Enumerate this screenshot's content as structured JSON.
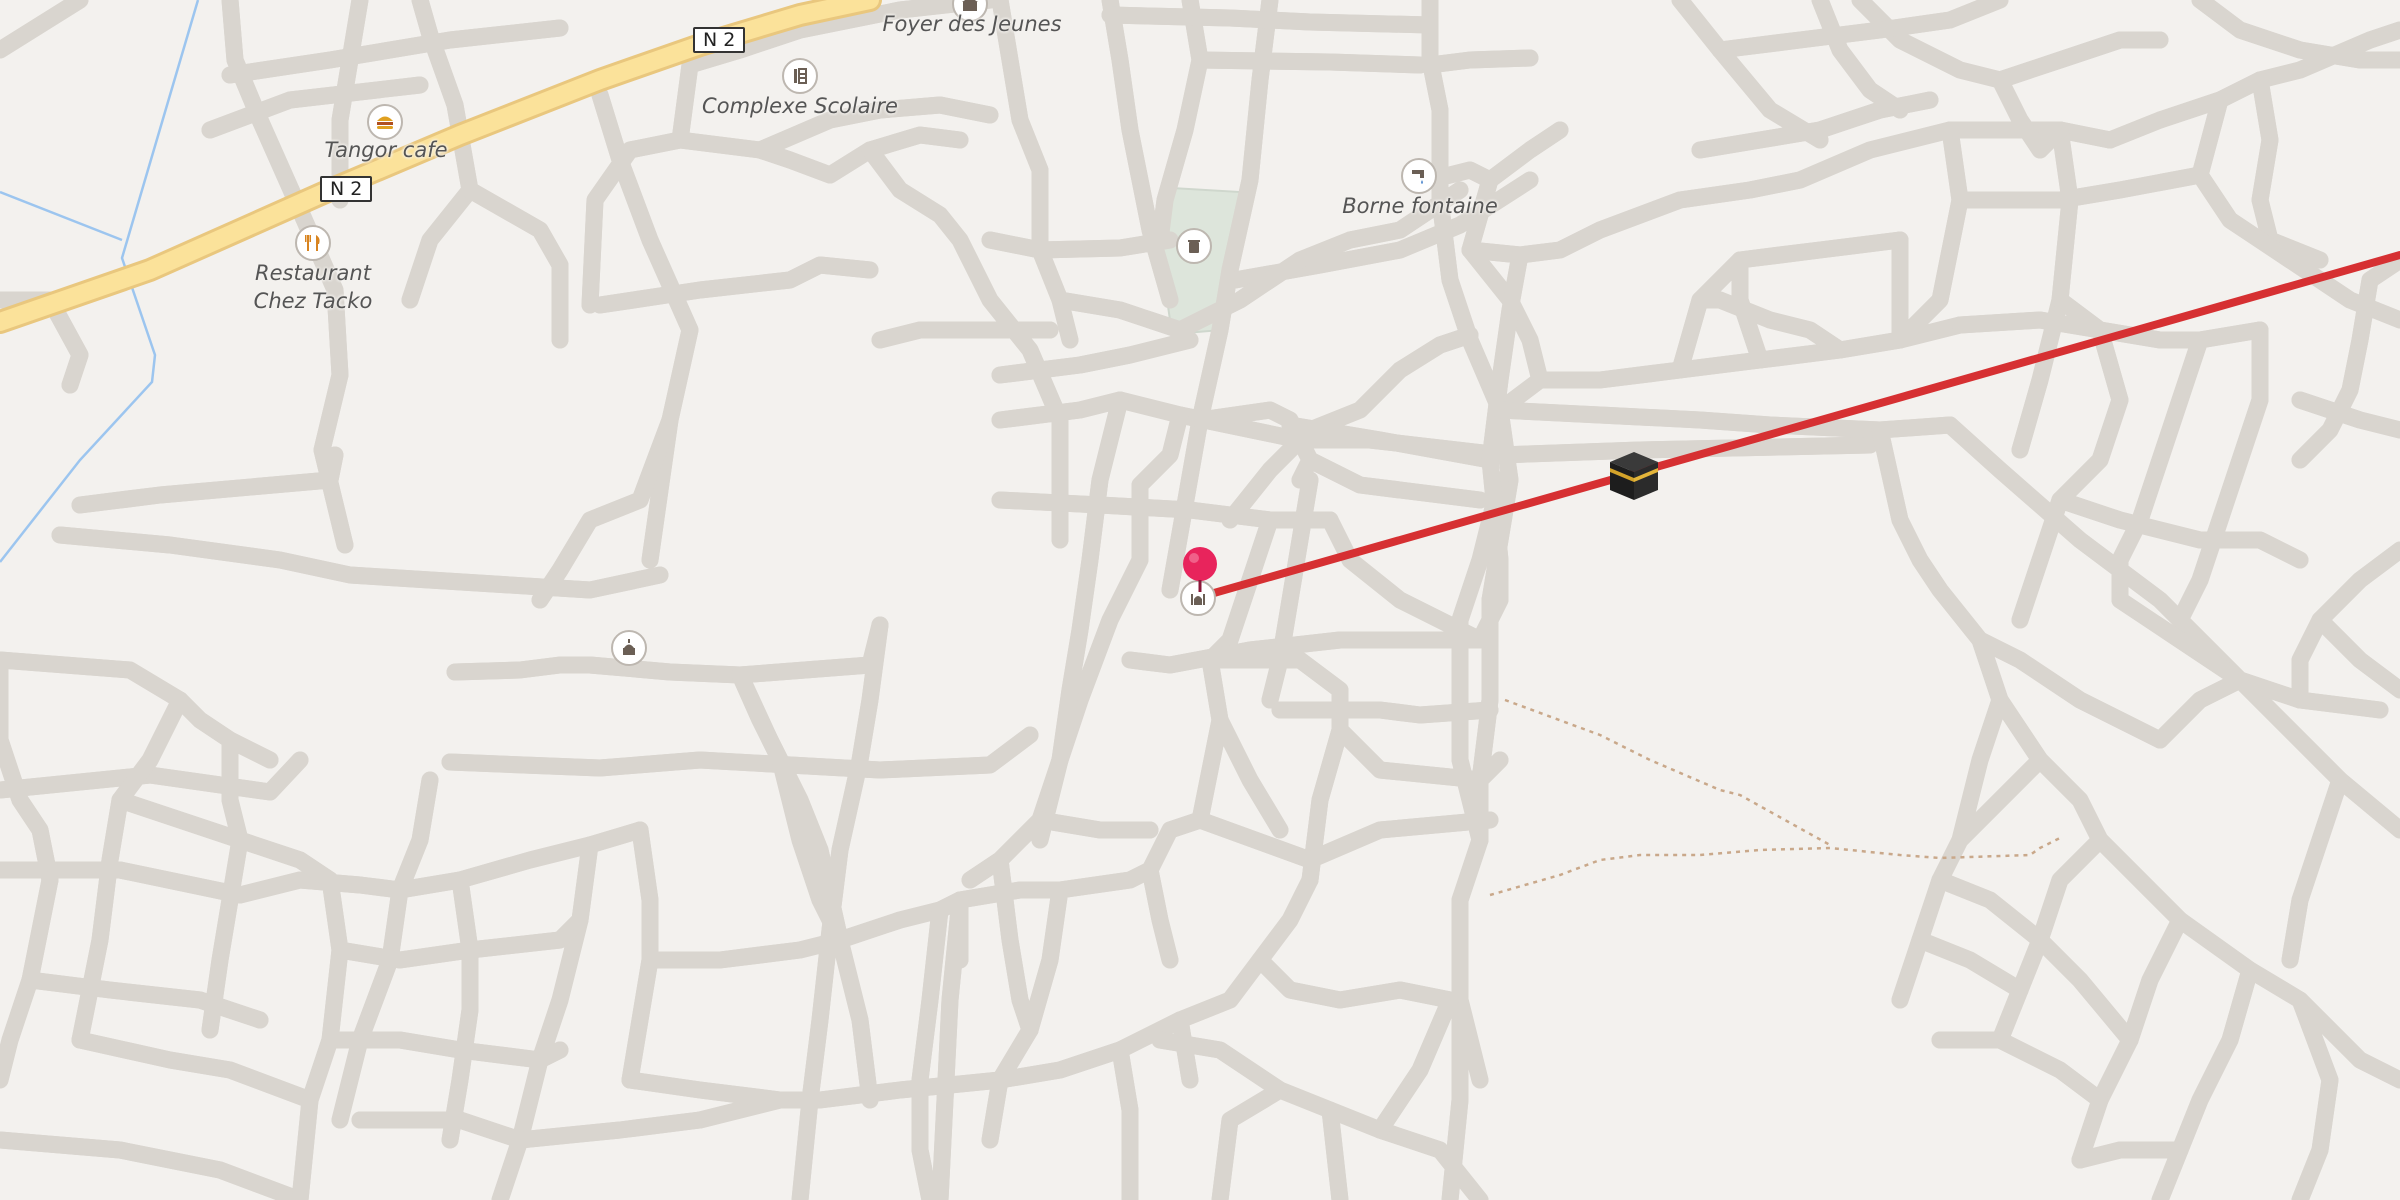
{
  "map": {
    "roads": [
      {
        "ref": "N 2",
        "label": "N 2"
      }
    ],
    "labels": {
      "foyer": "Foyer des Jeunes",
      "complexe": "Complexe Scolaire",
      "tangor": "Tangor cafe",
      "restaurant_line1": "Restaurant",
      "restaurant_line2": "Chez Tacko",
      "borne": "Borne fontaine"
    },
    "poi_icons": {
      "foyer": "community-centre-icon",
      "complexe": "school-icon",
      "tangor": "fast-food-icon",
      "restaurant": "restaurant-icon",
      "borne": "water-tap-icon",
      "cemetery": "cemetery-icon",
      "mosque_west": "mosque-icon",
      "mosque_center": "mosque-icon"
    },
    "qibla_line_color": "#d63032",
    "marker_color": "#e8245c",
    "kaaba_icon": "kaaba-icon",
    "road_color": "#ffffff",
    "trunk_color": "#fbe29a",
    "waterway_color": "#9cc5ef",
    "park_color": "#dde5db",
    "path_color": "#c9a88a"
  }
}
